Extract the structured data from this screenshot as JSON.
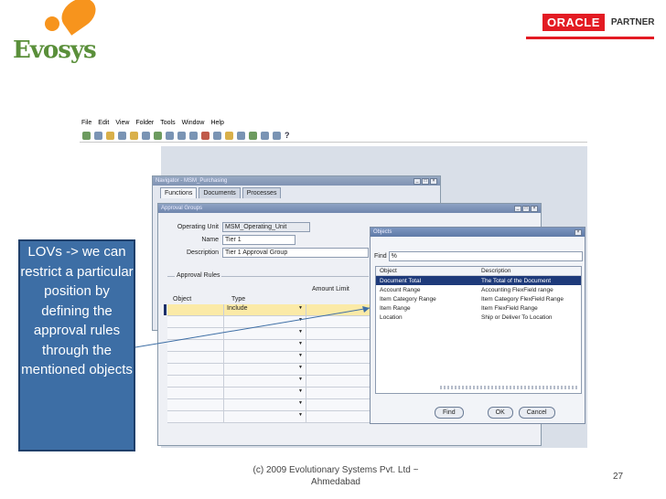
{
  "branding": {
    "logo_left_text": "Evosys",
    "logo_right_oracle": "ORACLE",
    "logo_right_partner": "PARTNER"
  },
  "app": {
    "menu": [
      "File",
      "Edit",
      "View",
      "Folder",
      "Tools",
      "Window",
      "Help"
    ],
    "toolbar_help_glyph": "?"
  },
  "navigator": {
    "title": "Navigator - MSM_Purchasing",
    "tabs": [
      "Functions",
      "Documents",
      "Processes"
    ]
  },
  "approval_groups": {
    "title": "Approval Groups",
    "operating_unit_label": "Operating Unit",
    "operating_unit_value": "MSM_Operating_Unit",
    "name_label": "Name",
    "name_value": "Tier 1",
    "description_label": "Description",
    "description_value": "Tier 1 Approval Group",
    "rules_group_label": "Approval Rules",
    "col_object": "Object",
    "col_type": "Type",
    "col_amount_limit": "Amount Limit",
    "first_row_type": "Include"
  },
  "objects_lov": {
    "title": "Objects",
    "find_label": "Find",
    "find_value": "%",
    "col_object": "Object",
    "col_description": "Description",
    "rows": [
      {
        "object": "Document Total",
        "description": "The Total of the Document"
      },
      {
        "object": "Account Range",
        "description": "Accounting FlexField range"
      },
      {
        "object": "Item Category Range",
        "description": "Item Category FlexField Range"
      },
      {
        "object": "Item Range",
        "description": "Item FlexField Range"
      },
      {
        "object": "Location",
        "description": "Ship or Deliver To Location"
      }
    ],
    "btn_find": "Find",
    "btn_ok": "OK",
    "btn_cancel": "Cancel"
  },
  "callout": {
    "text": "LOVs -> we can restrict a particular position  by defining the approval rules through the mentioned objects"
  },
  "footer": {
    "copyright": "(c) 2009 Evolutionary Systems Pvt. Ltd ~ Ahmedabad",
    "page_number": "27"
  },
  "colors": {
    "oracle_red": "#e31b23",
    "callout_blue": "#3d6ea5",
    "evosys_green": "#5a8f3a",
    "evosys_orange": "#f7941d",
    "selected_row": "#1e3a7a"
  }
}
